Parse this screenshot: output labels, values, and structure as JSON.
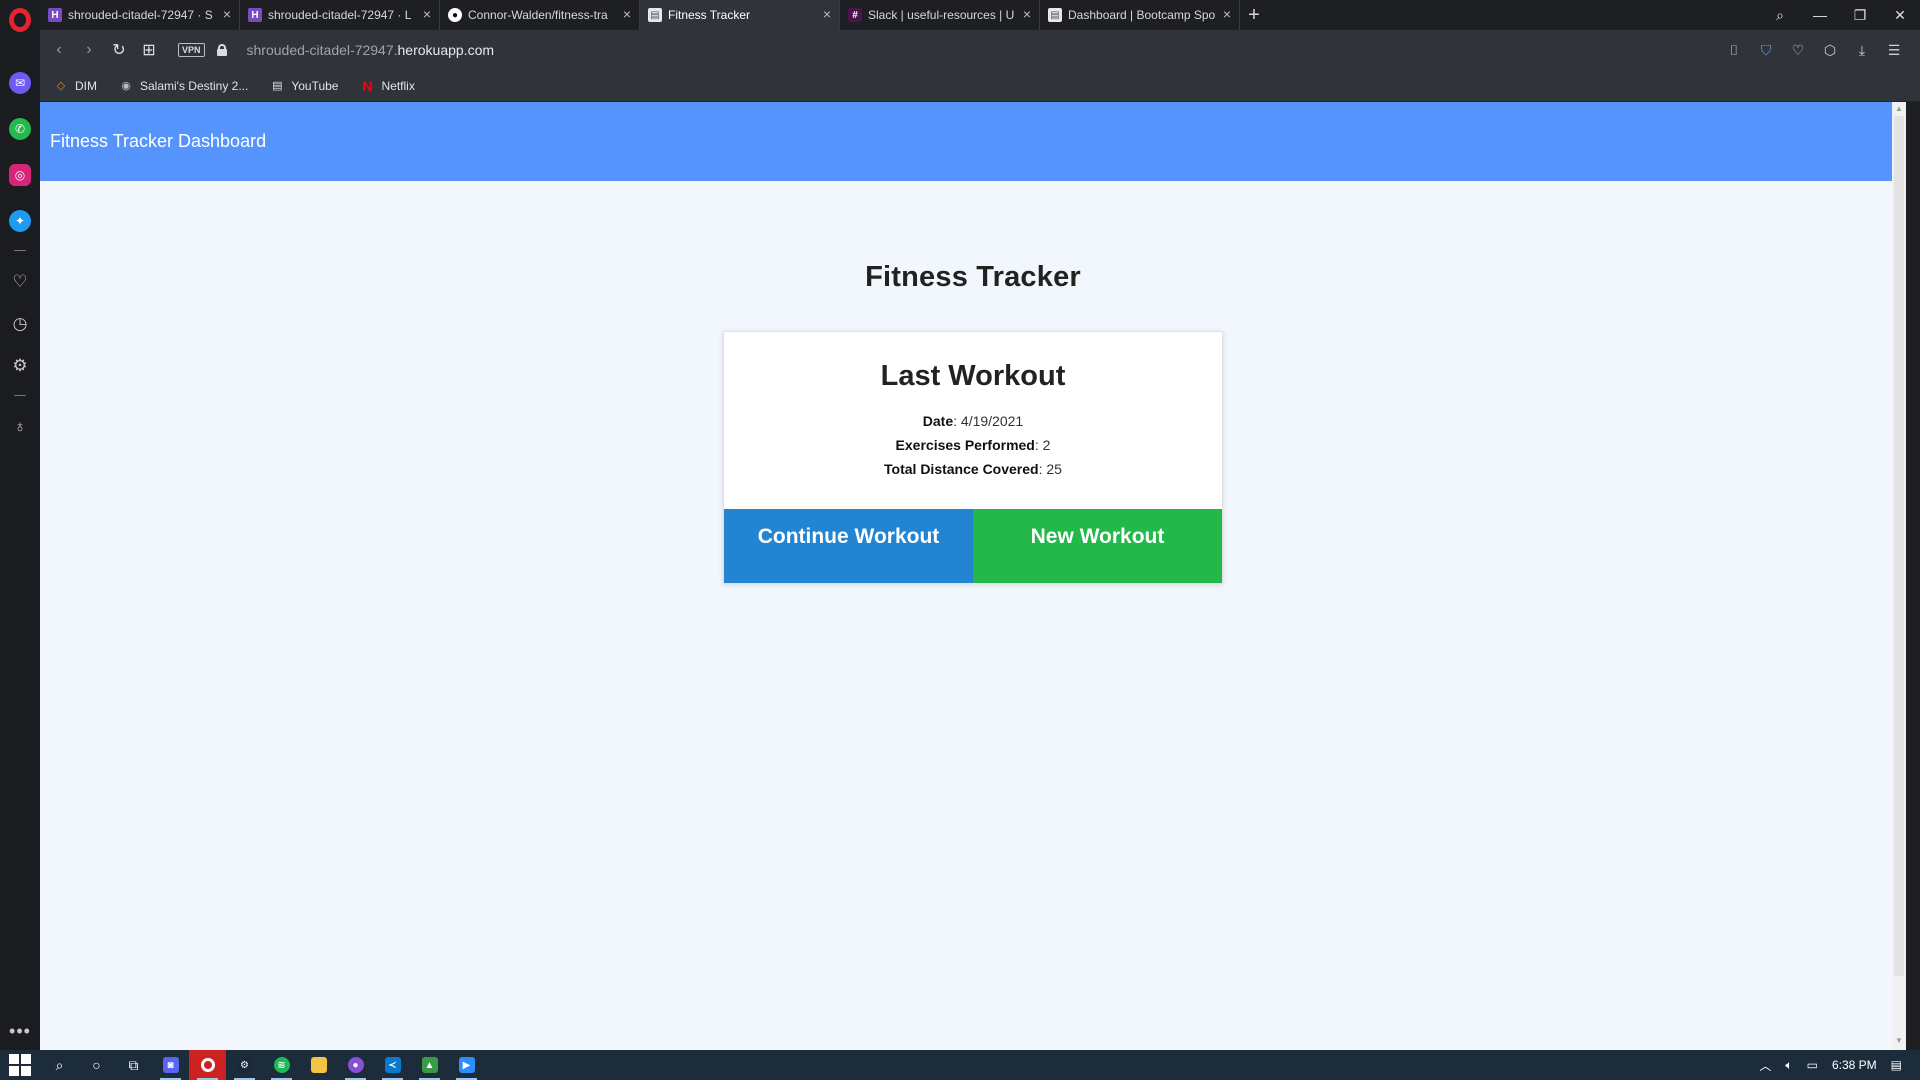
{
  "browser": {
    "tabs": [
      {
        "title": "shrouded-citadel-72947 · S",
        "favicon": "heroku-icon",
        "active": false
      },
      {
        "title": "shrouded-citadel-72947 · L",
        "favicon": "heroku-icon",
        "active": false
      },
      {
        "title": "Connor-Walden/fitness-tra",
        "favicon": "github-icon",
        "active": false
      },
      {
        "title": "Fitness Tracker",
        "favicon": "page-icon",
        "active": true
      },
      {
        "title": "Slack | useful-resources | U",
        "favicon": "slack-icon",
        "active": false
      },
      {
        "title": "Dashboard | Bootcamp Spo",
        "favicon": "page-icon",
        "active": false
      }
    ],
    "vpn_label": "VPN",
    "url_prefix": "shrouded-citadel-72947.",
    "url_host": "herokuapp.com",
    "bookmarks": [
      {
        "label": "DIM",
        "icon": "dim-icon"
      },
      {
        "label": "Salami's Destiny 2...",
        "icon": "destiny-icon"
      },
      {
        "label": "YouTube",
        "icon": "page-icon"
      },
      {
        "label": "Netflix",
        "icon": "netflix-icon"
      }
    ]
  },
  "app": {
    "navbar_brand": "Fitness Tracker Dashboard",
    "page_title": "Fitness Tracker",
    "card": {
      "title": "Last Workout",
      "date_label": "Date",
      "date_value": "4/19/2021",
      "exercises_label": "Exercises Performed",
      "exercises_value": "2",
      "distance_label": "Total Distance Covered",
      "distance_value": "25"
    },
    "buttons": {
      "continue": "Continue Workout",
      "new": "New Workout"
    }
  },
  "taskbar": {
    "clock": "6:38 PM"
  },
  "colors": {
    "navbar": "#5494fc",
    "continue_button": "#2385d2",
    "new_button": "#22b84a",
    "page_bg": "#f1f7fd"
  }
}
